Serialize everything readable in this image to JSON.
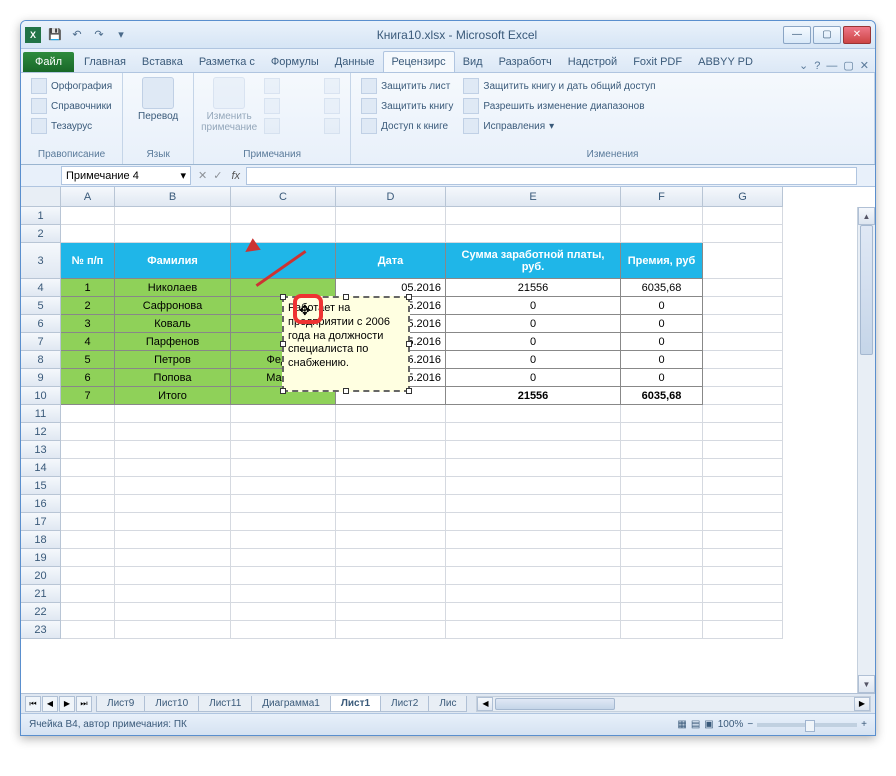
{
  "window": {
    "title": "Книга10.xlsx - Microsoft Excel"
  },
  "ribbon": {
    "file": "Файл",
    "tabs": [
      "Главная",
      "Вставка",
      "Разметка с",
      "Формулы",
      "Данные",
      "Рецензирс",
      "Вид",
      "Разработч",
      "Надстрой",
      "Foxit PDF",
      "ABBYY PD"
    ],
    "active_tab": 5,
    "groups": {
      "proofing": {
        "label": "Правописание",
        "items": [
          "Орфография",
          "Справочники",
          "Тезаурус"
        ]
      },
      "language": {
        "label": "Язык",
        "btn": "Перевод"
      },
      "comments": {
        "label": "Примечания",
        "btn": "Изменить примечание"
      },
      "changes": {
        "label": "Изменения",
        "col1": [
          "Защитить лист",
          "Защитить книгу",
          "Доступ к книге"
        ],
        "col2": [
          "Защитить книгу и дать общий доступ",
          "Разрешить изменение диапазонов",
          "Исправления"
        ]
      }
    }
  },
  "namebox": "Примечание 4",
  "columns": [
    "A",
    "B",
    "C",
    "D",
    "E",
    "F",
    "G"
  ],
  "header": {
    "num": "№ п/п",
    "fam": "Фамилия",
    "imya_a": "",
    "imya_b": "",
    "date": "Дата",
    "sum": "Сумма заработной платы, руб.",
    "prem": "Премия, руб"
  },
  "rows": [
    {
      "n": "1",
      "fam": "Николаев",
      "imya": "",
      "date": "05.2016",
      "sum": "21556",
      "prem": "6035,68"
    },
    {
      "n": "2",
      "fam": "Сафронова",
      "imya": "",
      "date": "05.2016",
      "sum": "0",
      "prem": "0"
    },
    {
      "n": "3",
      "fam": "Коваль",
      "imya": "",
      "date": "05.2016",
      "sum": "0",
      "prem": "0"
    },
    {
      "n": "4",
      "fam": "Парфенов",
      "imya": "",
      "date": "05.2016",
      "sum": "0",
      "prem": "0"
    },
    {
      "n": "5",
      "fam": "Петров",
      "imya": "Федор",
      "date": "25.05.2016",
      "sum": "0",
      "prem": "0"
    },
    {
      "n": "6",
      "fam": "Попова",
      "imya": "Мария",
      "date": "25.05.2016",
      "sum": "0",
      "prem": "0"
    },
    {
      "n": "7",
      "fam": "Итого",
      "imya": "",
      "date": "",
      "sum": "21556",
      "prem": "6035,68"
    }
  ],
  "comment": {
    "text": "Работает на предприятии с 2006 года на должности специалиста по снабжению."
  },
  "sheets": {
    "tabs": [
      "Лист9",
      "Лист10",
      "Лист11",
      "Диаграмма1",
      "Лист1",
      "Лист2",
      "Лис"
    ],
    "active": 4
  },
  "status": {
    "text": "Ячейка B4, автор примечания: ПК",
    "zoom": "100%"
  }
}
